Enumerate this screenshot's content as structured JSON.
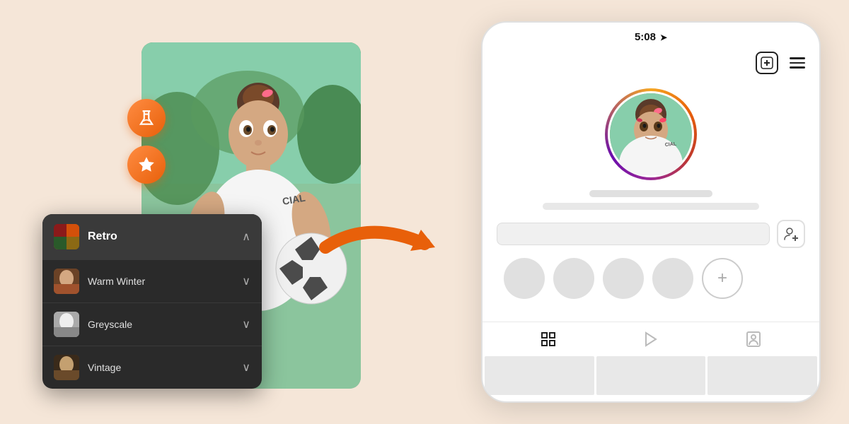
{
  "app": {
    "background_color": "#f5e6d8"
  },
  "left": {
    "tool_buttons": [
      {
        "id": "lab-btn",
        "icon": "lab",
        "label": "Lab"
      },
      {
        "id": "favorite-btn",
        "icon": "star",
        "label": "Favorite"
      }
    ],
    "dropdown": {
      "header_label": "Retro",
      "items": [
        {
          "id": "warm-winter",
          "label": "Warm Winter",
          "thumbnail": "warm"
        },
        {
          "id": "greyscale",
          "label": "Greyscale",
          "thumbnail": "grey"
        },
        {
          "id": "vintage",
          "label": "Vintage",
          "thumbnail": "vintage"
        }
      ]
    }
  },
  "right": {
    "phone": {
      "status_time": "5:08",
      "header_icons": [
        "plus",
        "menu"
      ],
      "avatar_ring_colors": [
        "#f5a623",
        "#e8600a",
        "#c0392b",
        "#9b2896"
      ],
      "add_friend_label": "Add Friend",
      "bottom_nav_icons": [
        "grid",
        "play",
        "portrait"
      ],
      "story_circles_count": 4
    }
  }
}
